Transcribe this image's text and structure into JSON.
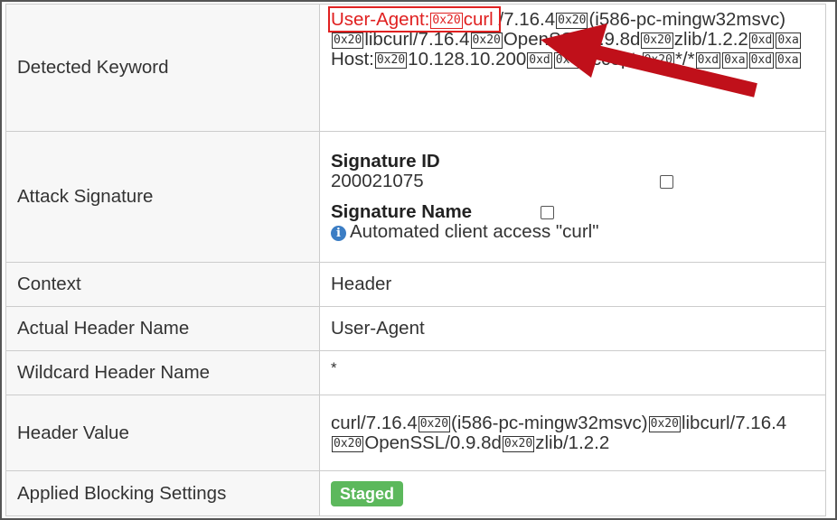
{
  "rows": {
    "detected_keyword": {
      "label": "Detected Keyword",
      "highlight": [
        "User-Agent:",
        "0x20",
        "curl"
      ],
      "rest": [
        [
          "t",
          "/7.16.4"
        ],
        [
          "h",
          "0x20"
        ],
        [
          "t",
          "(i586-pc-mingw32msvc)"
        ],
        [
          "h",
          "0x20"
        ],
        [
          "t",
          "libcurl/7.16.4"
        ],
        [
          "h",
          "0x20"
        ],
        [
          "t",
          "OpenSSL/0.9.8d"
        ],
        [
          "h",
          "0x20"
        ],
        [
          "t",
          "zlib/1.2.2"
        ],
        [
          "h",
          "0xd"
        ],
        [
          "h",
          "0xa"
        ],
        [
          "t",
          "Host:"
        ],
        [
          "h",
          "0x20"
        ],
        [
          "t",
          "10.128.10.200"
        ],
        [
          "h",
          "0xd"
        ],
        [
          "h",
          "0xa"
        ],
        [
          "t",
          "Accept:"
        ],
        [
          "h",
          "0x20"
        ],
        [
          "t",
          "*/*"
        ],
        [
          "h",
          "0xd"
        ],
        [
          "h",
          "0xa"
        ],
        [
          "h",
          "0xd"
        ],
        [
          "h",
          "0xa"
        ]
      ]
    },
    "attack_signature": {
      "label": "Attack Signature",
      "id_title": "Signature ID",
      "id_value": "200021075",
      "name_title": "Signature Name",
      "name_value": "Automated client access \"curl\"",
      "info_icon": "info-circle-icon"
    },
    "context": {
      "label": "Context",
      "value": "Header"
    },
    "actual_header": {
      "label": "Actual Header Name",
      "value": "User-Agent"
    },
    "wildcard_header": {
      "label": "Wildcard Header Name",
      "value": "*"
    },
    "header_value": {
      "label": "Header Value",
      "parts": [
        [
          "t",
          "curl/7.16.4"
        ],
        [
          "h",
          "0x20"
        ],
        [
          "t",
          "(i586-pc-mingw32msvc)"
        ],
        [
          "h",
          "0x20"
        ],
        [
          "t",
          "libcurl/7.16.4"
        ],
        [
          "h",
          "0x20"
        ],
        [
          "t",
          "OpenSSL/0.9.8d"
        ],
        [
          "h",
          "0x20"
        ],
        [
          "t",
          "zlib/1.2.2"
        ]
      ]
    },
    "blocking": {
      "label": "Applied Blocking Settings",
      "badge": "Staged"
    }
  },
  "colors": {
    "highlight": "#e02020",
    "arrow": "#c0101a",
    "badge": "#5cb85c",
    "info_icon": "#3b7dc4"
  }
}
